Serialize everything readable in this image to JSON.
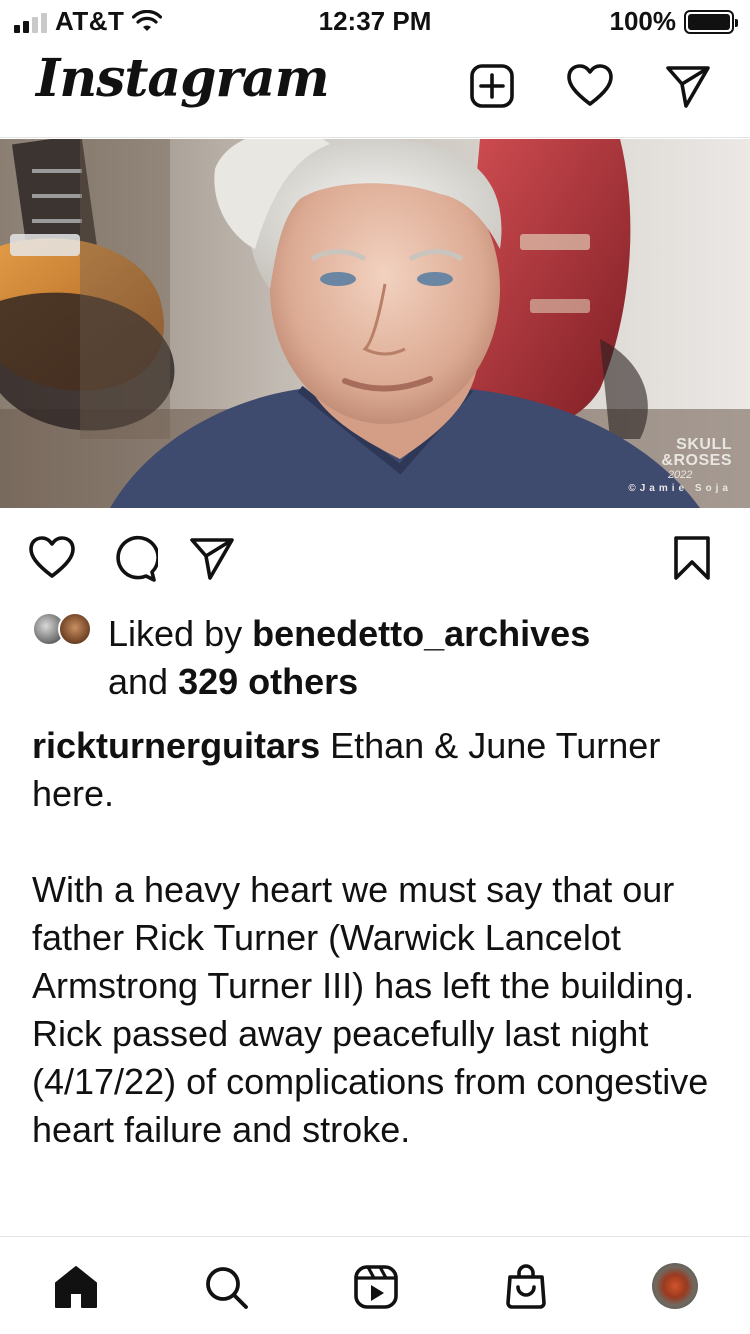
{
  "status_bar": {
    "carrier": "AT&T",
    "time": "12:37 PM",
    "battery": "100%",
    "battery_level": 1.0
  },
  "header": {
    "logo": "Instagram",
    "icons": [
      "new-post-icon",
      "heart-icon",
      "send-icon"
    ]
  },
  "post": {
    "photo_watermark": {
      "line1": "SKULL",
      "line2": "&ROSES",
      "year": "2022",
      "credit": "©Jamie Soja"
    },
    "actions": [
      "like-icon",
      "comment-icon",
      "share-icon",
      "save-icon"
    ],
    "likes": {
      "prefix": "Liked by ",
      "user": "benedetto_archives",
      "middle": "and ",
      "others": "329 others"
    },
    "caption": {
      "username": "rickturnerguitars",
      "first_text": " Ethan & June Turner here.",
      "paragraph2": "With a heavy heart we must say that our father Rick Turner (Warwick Lancelot Armstrong Turner III) has left the building. Rick passed away peacefully last night (4/17/22) of complications from congestive heart failure and stroke."
    }
  },
  "bottom_nav": {
    "items": [
      "home-icon",
      "search-icon",
      "reels-icon",
      "shop-icon",
      "profile-avatar"
    ]
  },
  "colors": {
    "text": "#111111",
    "divider": "#e3e3e3",
    "shirt": "#3e4a6e",
    "guitar_red": "#b6343a"
  }
}
